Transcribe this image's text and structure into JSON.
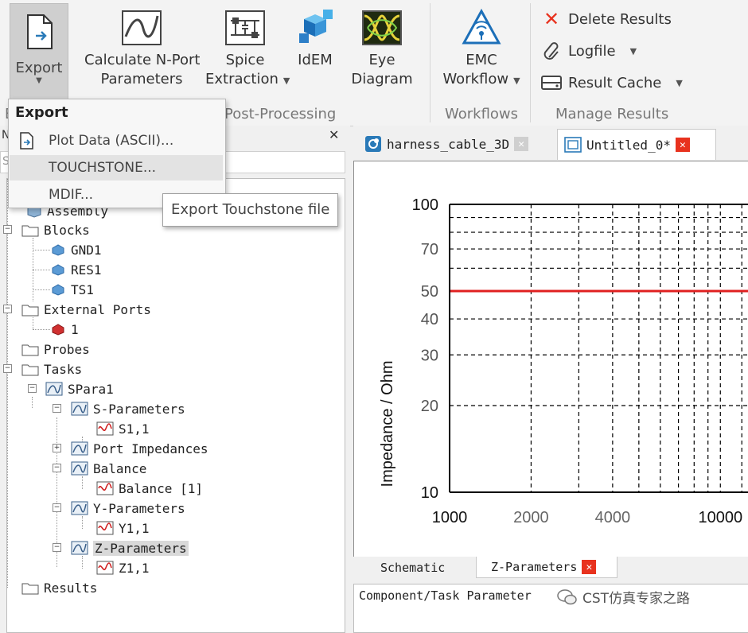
{
  "ribbon": {
    "export": {
      "label": "Export"
    },
    "calc_nport": {
      "label_line1": "Calculate N-Port",
      "label_line2": "Parameters"
    },
    "spice": {
      "label_line1": "Spice",
      "label_line2": "Extraction"
    },
    "idem": {
      "label": "IdEM"
    },
    "eye": {
      "label_line1": "Eye",
      "label_line2": "Diagram"
    },
    "emc": {
      "label_line1": "EMC",
      "label_line2": "Workflow"
    },
    "delete_results": {
      "label": "Delete Results"
    },
    "logfile": {
      "label": "Logfile"
    },
    "result_cache": {
      "label": "Result Cache"
    },
    "groups": {
      "post_processing": "Post-Processing",
      "workflows": "Workflows",
      "manage_results": "Manage Results",
      "first_letter": "E"
    }
  },
  "export_menu": {
    "header": "Export",
    "items": [
      {
        "label": "Plot Data (ASCII)..."
      },
      {
        "label": "TOUCHSTONE..."
      },
      {
        "label": "MDIF..."
      }
    ]
  },
  "tooltip": "Export Touchstone file",
  "left_panel": {
    "header_fragment": "Ne",
    "search_fragment": "Se",
    "close_symbol": "✕"
  },
  "tree": [
    {
      "label": "Assembly"
    },
    {
      "label": "Blocks"
    },
    {
      "label": "GND1"
    },
    {
      "label": "RES1"
    },
    {
      "label": "TS1"
    },
    {
      "label": "External Ports"
    },
    {
      "label": "1"
    },
    {
      "label": "Probes"
    },
    {
      "label": "Tasks"
    },
    {
      "label": "SPara1"
    },
    {
      "label": "S-Parameters"
    },
    {
      "label": "S1,1"
    },
    {
      "label": "Port Impedances"
    },
    {
      "label": "Balance"
    },
    {
      "label": "Balance [1]"
    },
    {
      "label": "Y-Parameters"
    },
    {
      "label": "Y1,1"
    },
    {
      "label": "Z-Parameters"
    },
    {
      "label": "Z1,1"
    },
    {
      "label": "Results"
    }
  ],
  "tabs": [
    {
      "label": "harness_cable_3D"
    },
    {
      "label": "Untitled_0*"
    }
  ],
  "bottom_tabs": [
    {
      "label": "Schematic"
    },
    {
      "label": "Z-Parameters"
    }
  ],
  "lower_panel": {
    "header": "Component/Task Parameter"
  },
  "watermark": "CST仿真专家之路",
  "colors": {
    "accent_red": "#e8321e",
    "series_red": "#e02020",
    "selection": "#d9d9d9"
  },
  "chart_data": {
    "type": "line",
    "ylabel": "Impedance / Ohm",
    "xlabel": "",
    "x_scale": "log",
    "y_scale": "log",
    "xlim": [
      1000,
      14000
    ],
    "ylim": [
      10,
      100
    ],
    "x_ticks": [
      1000,
      2000,
      4000,
      10000
    ],
    "x_tick_labels": [
      "1000",
      "2000",
      "4000",
      "10000"
    ],
    "y_ticks": [
      10,
      20,
      30,
      40,
      50,
      70,
      100
    ],
    "y_tick_labels": [
      "10",
      "20",
      "30",
      "40",
      "50",
      "70",
      "100"
    ],
    "grid": true,
    "series": [
      {
        "x": [
          1000,
          14000
        ],
        "y": [
          50,
          50
        ],
        "color": "#e02020"
      }
    ]
  }
}
